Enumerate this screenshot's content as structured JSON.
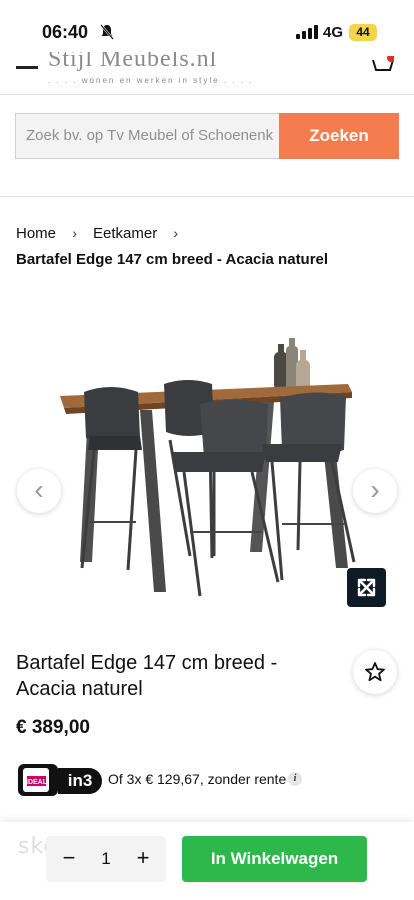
{
  "status_bar": {
    "time": "06:40",
    "network": "4G",
    "battery": "44",
    "battery_color": "#f4d44b"
  },
  "header": {
    "logo_text": "Stijl Meubels.nl",
    "logo_tagline": ". . . . wonen en werken in style . . . .",
    "menu_icon": "hamburger-icon",
    "cart_icon": "cart-icon"
  },
  "search": {
    "placeholder": "Zoek bv. op Tv Meubel of Schoenenk",
    "button_label": "Zoeken",
    "button_color": "#f47c4e"
  },
  "breadcrumb": {
    "items": [
      "Home",
      "Eetkamer"
    ],
    "current": "Bartafel Edge 147 cm breed - Acacia naturel"
  },
  "gallery": {
    "prev_icon": "chevron-left-icon",
    "next_icon": "chevron-right-icon",
    "zoom_icon": "expand-icon"
  },
  "product": {
    "title": "Bartafel Edge 147 cm breed - Acacia naturel",
    "price": "€ 389,00",
    "wishlist_icon": "star-icon",
    "payment": {
      "ideal_label": "iDEAL",
      "in3_label": "in3",
      "installment_text": "Of 3x € 129,67, zonder rente",
      "info_icon": "info-icon"
    }
  },
  "bottom_bar": {
    "minus": "−",
    "quantity": "1",
    "plus": "+",
    "add_to_cart": "In Winkelwagen",
    "add_to_cart_color": "#2db84b",
    "watermark": "skelbiu.lt"
  }
}
